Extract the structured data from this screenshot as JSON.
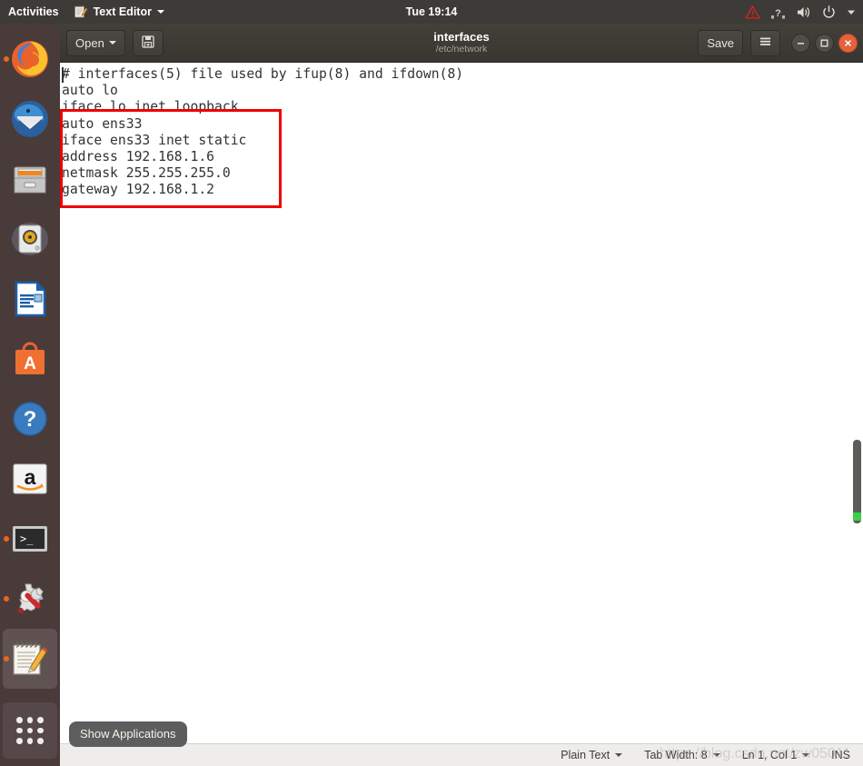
{
  "topbar": {
    "activities": "Activities",
    "app_menu_label": "Text Editor",
    "app_menu_icon": "text-editor-icon",
    "clock": "Tue 19:14",
    "tray": [
      {
        "name": "warning-triangle-icon",
        "label": "warning"
      },
      {
        "name": "network-unknown-icon",
        "label": "network"
      },
      {
        "name": "volume-icon",
        "label": "volume"
      },
      {
        "name": "power-icon",
        "label": "power"
      },
      {
        "name": "chevron-down-icon",
        "label": "system menu"
      }
    ]
  },
  "dock": {
    "items": [
      {
        "name": "dock-item-firefox",
        "icon": "firefox-icon",
        "label": "Firefox",
        "running": true,
        "active": false
      },
      {
        "name": "dock-item-thunderbird",
        "icon": "thunderbird-icon",
        "label": "Thunderbird Mail",
        "running": false,
        "active": false
      },
      {
        "name": "dock-item-files",
        "icon": "files-icon",
        "label": "Files",
        "running": false,
        "active": false
      },
      {
        "name": "dock-item-rhythmbox",
        "icon": "rhythmbox-icon",
        "label": "Rhythmbox",
        "running": false,
        "active": false
      },
      {
        "name": "dock-item-libreoffice-writer",
        "icon": "libreoffice-writer-icon",
        "label": "LibreOffice Writer",
        "running": false,
        "active": false
      },
      {
        "name": "dock-item-ubuntu-software",
        "icon": "ubuntu-software-icon",
        "label": "Ubuntu Software",
        "running": false,
        "active": false
      },
      {
        "name": "dock-item-help",
        "icon": "help-icon",
        "label": "Help",
        "running": false,
        "active": false
      },
      {
        "name": "dock-item-amazon",
        "icon": "amazon-icon",
        "label": "Amazon",
        "running": false,
        "active": false
      },
      {
        "name": "dock-item-terminal",
        "icon": "terminal-icon",
        "label": "Terminal",
        "running": true,
        "active": false
      },
      {
        "name": "dock-item-settings",
        "icon": "settings-wrench-gear-icon",
        "label": "System Settings",
        "running": true,
        "active": false
      },
      {
        "name": "dock-item-text-editor",
        "icon": "text-editor-icon",
        "label": "Text Editor",
        "running": true,
        "active": true
      }
    ],
    "show_applications": {
      "name": "show-applications-button",
      "icon": "grid-nine-dots-icon",
      "tooltip": "Show Applications"
    }
  },
  "window": {
    "header": {
      "open_label": "Open",
      "open_icon": "chevron-down-icon",
      "new_doc_icon": "save-as-icon",
      "title": "interfaces",
      "subtitle": "/etc/network",
      "save_label": "Save",
      "menu_icon": "hamburger-menu-icon",
      "minimize_icon": "minimize-icon",
      "maximize_icon": "maximize-icon",
      "close_icon": "close-icon"
    },
    "document": {
      "text": "# interfaces(5) file used by ifup(8) and ifdown(8)\nauto lo\niface lo inet loopback\nauto ens33\niface ens33 inet static\naddress 192.168.1.6\nnetmask 255.255.255.0\ngateway 192.168.1.2",
      "lines": [
        "# interfaces(5) file used by ifup(8) and ifdown(8)",
        "auto lo",
        "iface lo inet loopback",
        "auto ens33",
        "iface ens33 inet static",
        "address 192.168.1.6",
        "netmask 255.255.255.0",
        "gateway 192.168.1.2"
      ],
      "annotation": {
        "name": "red-highlight-rectangle",
        "color": "#ee0000",
        "covers_lines": [
          "auto ens33",
          "iface ens33 inet static",
          "address 192.168.1.6",
          "netmask 255.255.255.0",
          "gateway 192.168.1.2"
        ]
      }
    },
    "statusbar": {
      "language": "Plain Text",
      "tab_width": "Tab Width: 8",
      "position": "Ln 1, Col 1",
      "insert_mode": "INS",
      "caret_icon": "chevron-down-icon"
    },
    "watermark": "https://blog.csdn.net/zw05011"
  },
  "colors": {
    "topbar_bg": "#3c3b37",
    "dock_bg": "#4a3b3b",
    "headerbar_bg": "#3c3b37",
    "close_button": "#e3633c",
    "accent_orange": "#e8671c",
    "annotation_red": "#ee0000",
    "statusbar_bg": "#efedeb",
    "text_fg": "#2e3436"
  }
}
